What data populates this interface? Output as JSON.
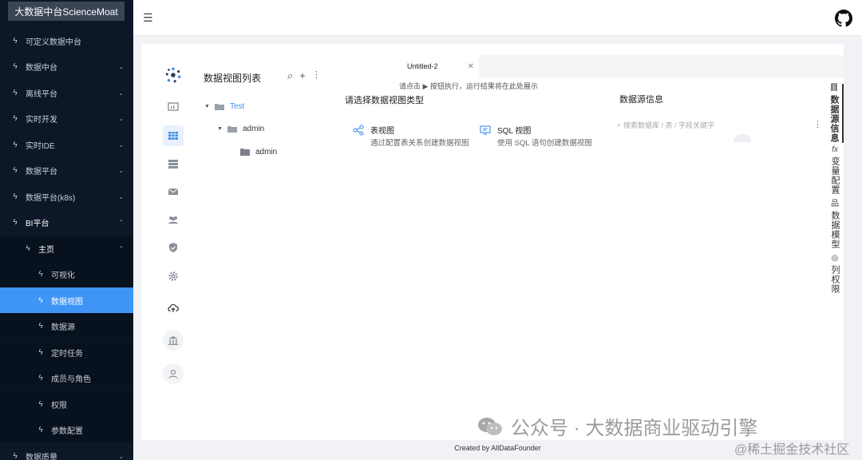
{
  "app": {
    "title": "大数据中台ScienceMoat"
  },
  "nav": {
    "items": [
      {
        "label": "可定义数据中台",
        "chevron": ""
      },
      {
        "label": "数据中台",
        "chevron": "⌄"
      },
      {
        "label": "离线平台",
        "chevron": "⌄"
      },
      {
        "label": "实时开发",
        "chevron": "⌄"
      },
      {
        "label": "实时IDE",
        "chevron": "⌄"
      },
      {
        "label": "数据平台",
        "chevron": "⌄"
      },
      {
        "label": "数据平台(k8s)",
        "chevron": "⌄"
      },
      {
        "label": "BI平台",
        "chevron": "⌃"
      },
      {
        "label": "主页",
        "chevron": "⌃"
      },
      {
        "label": "可视化",
        "chevron": ""
      },
      {
        "label": "数据视图",
        "chevron": ""
      },
      {
        "label": "数据源",
        "chevron": ""
      },
      {
        "label": "定时任务",
        "chevron": ""
      },
      {
        "label": "成员与角色",
        "chevron": ""
      },
      {
        "label": "权限",
        "chevron": ""
      },
      {
        "label": "参数配置",
        "chevron": ""
      },
      {
        "label": "数据质量",
        "chevron": "⌄"
      }
    ]
  },
  "tree": {
    "title": "数据视图列表",
    "nodes": [
      {
        "label": "Test"
      },
      {
        "label": "admin"
      },
      {
        "label": "admin"
      }
    ]
  },
  "editor": {
    "tab_label": "Untitled-2",
    "hint": "请点击 ▶ 按钮执行，运行结果将在此处展示",
    "choose_title": "请选择数据视图类型",
    "options": [
      {
        "title": "表视图",
        "desc": "通过配置表关系创建数据视图"
      },
      {
        "title": "SQL 视图",
        "desc": "使用 SQL 语句创建数据视图"
      }
    ]
  },
  "datasource": {
    "title": "数据源信息",
    "search_placeholder": "搜索数据库 / 表 / 字段关键字"
  },
  "right_tabs": [
    {
      "icon": "目",
      "label": "数据源信息"
    },
    {
      "icon": "fx",
      "label": "变量配置"
    },
    {
      "icon": "品",
      "label": "数据模型"
    },
    {
      "icon": "◎",
      "label": "列权限"
    }
  ],
  "footer": {
    "text": "Created by AllDataFounder"
  },
  "watermark": {
    "line1": "公众号 · 大数据商业驱动引擎",
    "line2": "@稀土掘金技术社区"
  },
  "colors": {
    "nav_bg": "#0c1727",
    "active": "#3e95f6",
    "accent": "#3e8ee9"
  }
}
